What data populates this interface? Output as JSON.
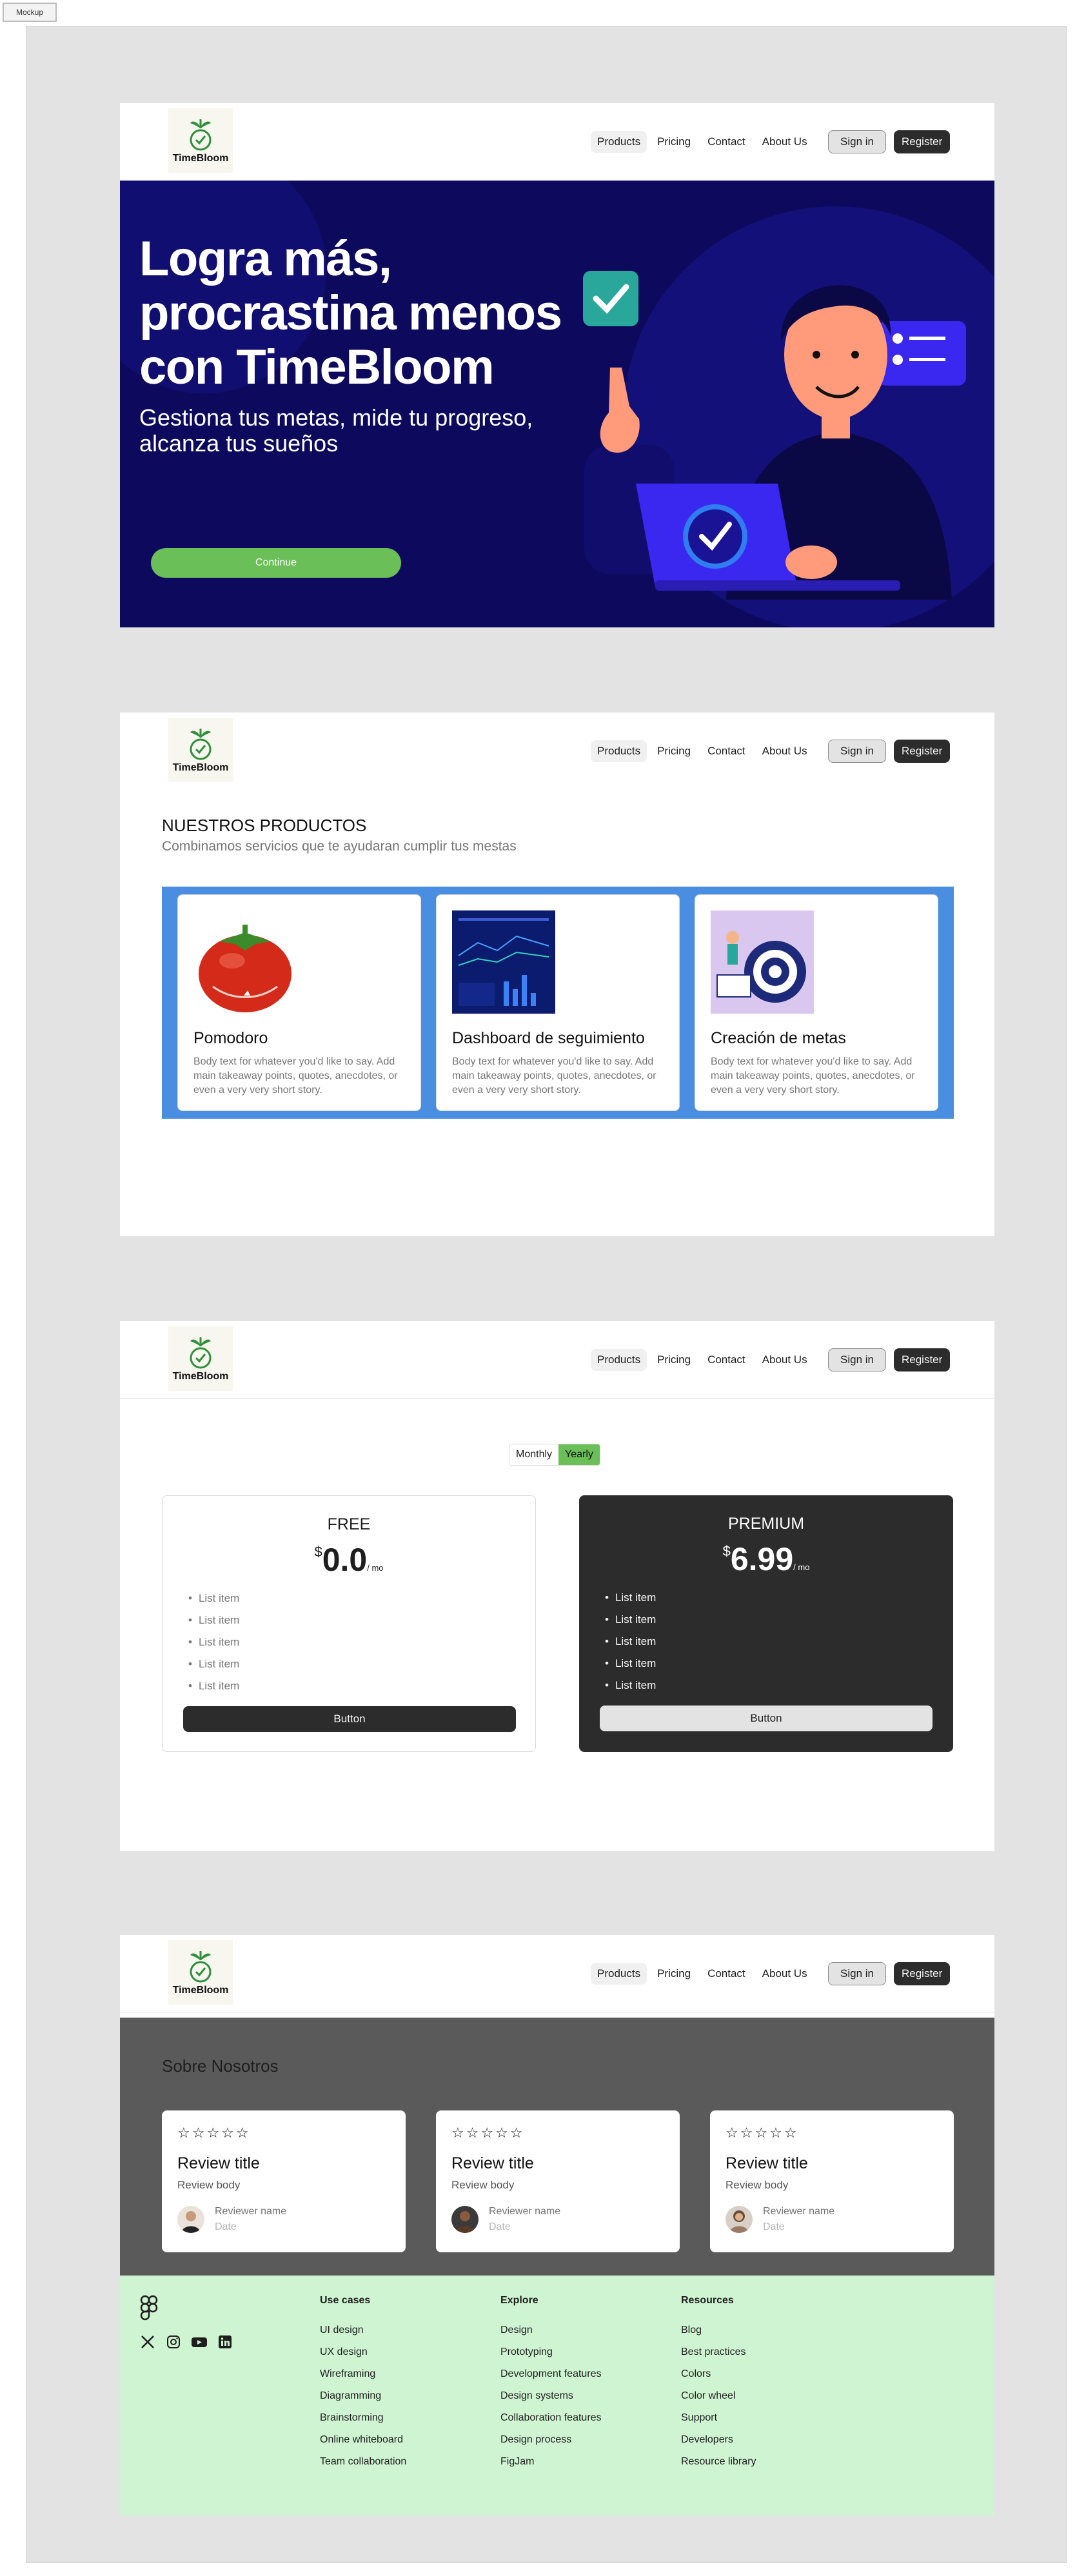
{
  "mockup_tag": "Mockup",
  "brand": {
    "name": "TimeBloom"
  },
  "nav": {
    "links": [
      "Products",
      "Pricing",
      "Contact",
      "About Us"
    ],
    "sign_in": "Sign in",
    "register": "Register"
  },
  "hero": {
    "title": "Logra más, procrastina menos con TimeBloom",
    "subtitle": "Gestiona tus metas, mide tu progreso, alcanza tus sueños",
    "cta": "Continue"
  },
  "products": {
    "title": "NUESTROS PRODUCTOS",
    "subtitle": "Combinamos servicios que te ayudaran cumplir tus mestas",
    "cards": [
      {
        "title": "Pomodoro",
        "body": "Body text for whatever you'd like to say. Add main takeaway points, quotes, anecdotes, or even a very very short story."
      },
      {
        "title": "Dashboard de seguimiento",
        "body": "Body text for whatever you'd like to say. Add main takeaway points, quotes, anecdotes, or even a very very short story."
      },
      {
        "title": "Creación de metas",
        "body": "Body text for whatever you'd like to say. Add main takeaway points, quotes, anecdotes, or even a very very short story."
      }
    ]
  },
  "pricing": {
    "toggle": {
      "monthly": "Monthly",
      "yearly": "Yearly",
      "selected": "Yearly"
    },
    "plans": [
      {
        "name": "FREE",
        "currency": "$",
        "price": "0.0",
        "period": "/ mo",
        "items": [
          "List item",
          "List item",
          "List item",
          "List item",
          "List item"
        ],
        "button": "Button"
      },
      {
        "name": "PREMIUM",
        "currency": "$",
        "price": "6.99",
        "period": "/ mo",
        "items": [
          "List item",
          "List item",
          "List item",
          "List item",
          "List item"
        ],
        "button": "Button"
      }
    ]
  },
  "about": {
    "title": "Sobre Nosotros",
    "reviews": [
      {
        "stars": "☆☆☆☆☆",
        "title": "Review title",
        "body": "Review body",
        "name": "Reviewer name",
        "date": "Date"
      },
      {
        "stars": "☆☆☆☆☆",
        "title": "Review title",
        "body": "Review body",
        "name": "Reviewer name",
        "date": "Date"
      },
      {
        "stars": "☆☆☆☆☆",
        "title": "Review title",
        "body": "Review body",
        "name": "Reviewer name",
        "date": "Date"
      }
    ]
  },
  "footer": {
    "columns": [
      {
        "title": "Use cases",
        "links": [
          "UI design",
          "UX design",
          "Wireframing",
          "Diagramming",
          "Brainstorming",
          "Online whiteboard",
          "Team collaboration"
        ]
      },
      {
        "title": "Explore",
        "links": [
          "Design",
          "Prototyping",
          "Development features",
          "Design systems",
          "Collaboration features",
          "Design process",
          "FigJam"
        ]
      },
      {
        "title": "Resources",
        "links": [
          "Blog",
          "Best practices",
          "Colors",
          "Color wheel",
          "Support",
          "Developers",
          "Resource library"
        ]
      }
    ],
    "socials": [
      "x-icon",
      "instagram-icon",
      "youtube-icon",
      "linkedin-icon"
    ]
  },
  "colors": {
    "hero_bg": "#0d0a5e",
    "accent_green": "#6bbf59",
    "products_band": "#4a8ee1",
    "about_bg": "#5a5a5a",
    "footer_bg": "#cff4d2",
    "dark": "#2c2c2c"
  }
}
